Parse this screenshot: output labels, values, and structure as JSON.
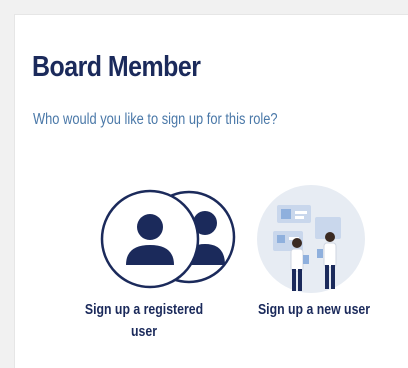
{
  "page": {
    "title": "Board Member",
    "subtitle": "Who would you like to sign up for this role?"
  },
  "options": [
    {
      "label": "Sign up a registered user",
      "icon": "registered-users-icon"
    },
    {
      "label": "Sign up a new user",
      "icon": "new-user-illustration"
    }
  ],
  "colors": {
    "heading": "#1b2a5b",
    "subtitle": "#4a78a8",
    "background": "#f1f1f1",
    "panel": "#ffffff"
  }
}
